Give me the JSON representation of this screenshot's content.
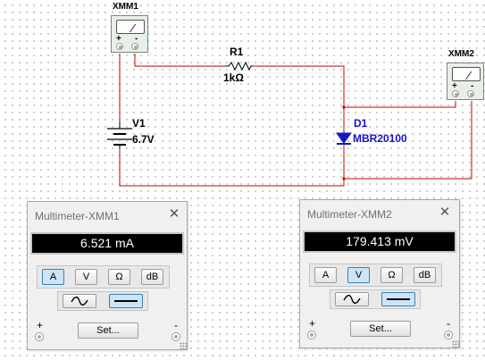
{
  "schematic": {
    "xmm1": {
      "label": "XMM1",
      "plus": "+",
      "minus": "-"
    },
    "xmm2": {
      "label": "XMM2",
      "plus": "+",
      "minus": "-"
    },
    "r1": {
      "ref": "R1",
      "value": "1kΩ"
    },
    "v1": {
      "ref": "V1",
      "value": "6.7V"
    },
    "d1": {
      "ref": "D1",
      "value": "MBR20100"
    },
    "wire_color": "#cc0000",
    "diode_color": "#1515c8"
  },
  "multimeter1": {
    "title": "Multimeter-XMM1",
    "reading": "6.521 mA",
    "mode_buttons": [
      "A",
      "V",
      "Ω",
      "dB"
    ],
    "active_mode": "A",
    "active_wave": "dc",
    "set_label": "Set...",
    "plus_label": "+",
    "minus_label": "-",
    "close_symbol": "✕"
  },
  "multimeter2": {
    "title": "Multimeter-XMM2",
    "reading": "179.413 mV",
    "mode_buttons": [
      "A",
      "V",
      "Ω",
      "dB"
    ],
    "active_mode": "V",
    "active_wave": "dc",
    "set_label": "Set...",
    "plus_label": "+",
    "minus_label": "-",
    "close_symbol": "✕"
  }
}
